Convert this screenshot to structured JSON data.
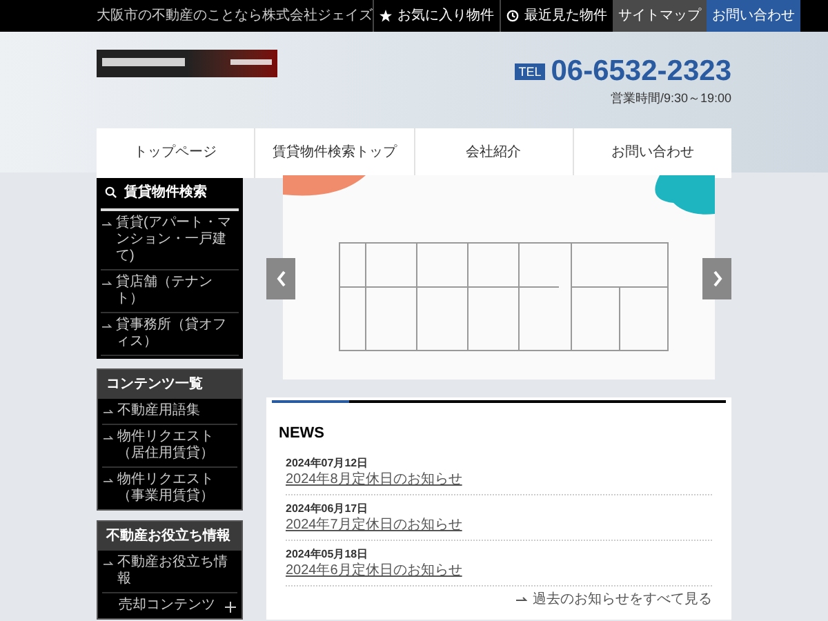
{
  "top_bar": {
    "tagline": "大阪市の不動産のことなら株式会社ジェイズ",
    "links": [
      {
        "label": "お気に入り物件",
        "kind": "star"
      },
      {
        "label": "最近見た物件",
        "kind": "history"
      },
      {
        "label": "サイトマップ",
        "kind": "gray"
      },
      {
        "label": "お問い合わせ",
        "kind": "blue"
      }
    ]
  },
  "header": {
    "tel_badge": "TEL",
    "phone": "06-6532-2323",
    "hours": "営業時間/9:30～19:00"
  },
  "nav": [
    "トップページ",
    "賃貸物件検索トップ",
    "会社紹介",
    "お問い合わせ"
  ],
  "sidebar": [
    {
      "title": "賃貸物件検索",
      "kind": "search",
      "items": [
        {
          "label": "賃貸(アパート・マンション・一戸建て)",
          "expandable": false
        },
        {
          "label": "貸店舗（テナント）",
          "expandable": false
        },
        {
          "label": "貸事務所（貸オフィス）",
          "expandable": false
        }
      ]
    },
    {
      "title": "コンテンツ一覧",
      "kind": "plain",
      "items": [
        {
          "label": "不動産用語集",
          "expandable": false
        },
        {
          "label": "物件リクエスト（居住用賃貸）",
          "expandable": false
        },
        {
          "label": "物件リクエスト（事業用賃貸）",
          "expandable": false
        }
      ]
    },
    {
      "title": "不動産お役立ち情報",
      "kind": "plain",
      "items": [
        {
          "label": "不動産お役立ち情報",
          "expandable": false
        },
        {
          "label": "売却コンテンツ",
          "expandable": true
        }
      ]
    }
  ],
  "news": {
    "title": "NEWS",
    "items": [
      {
        "date": "2024年07月12日",
        "title": "2024年8月定休日のお知らせ"
      },
      {
        "date": "2024年06月17日",
        "title": "2024年7月定休日のお知らせ"
      },
      {
        "date": "2024年05月18日",
        "title": "2024年6月定休日のお知らせ"
      }
    ],
    "more": "過去のお知らせをすべて見る"
  }
}
